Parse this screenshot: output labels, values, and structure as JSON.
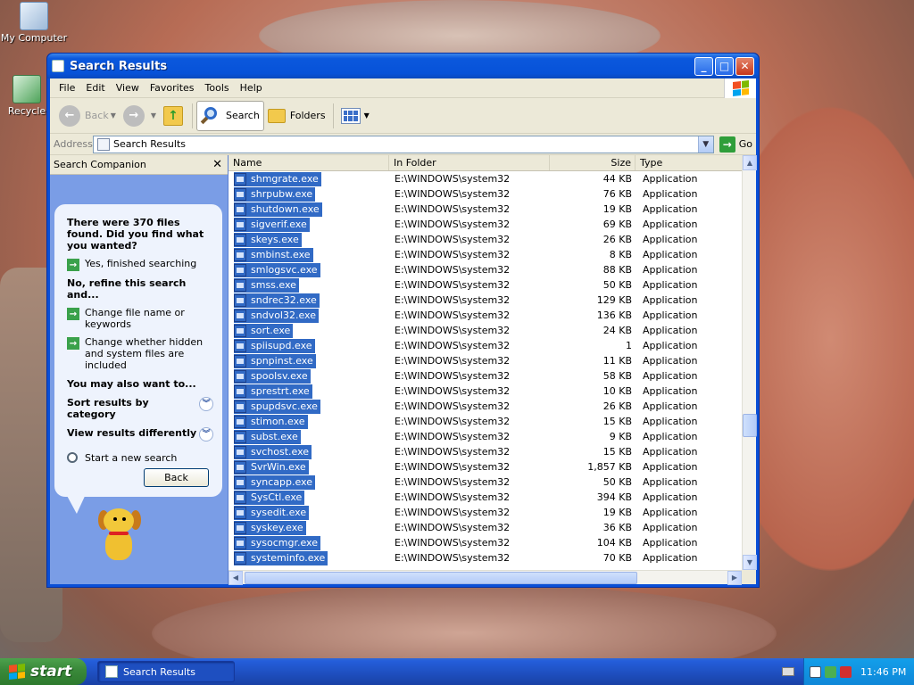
{
  "desktop": {
    "icons": [
      {
        "label": "My Computer"
      },
      {
        "label": "Recycle"
      }
    ]
  },
  "window": {
    "title": "Search Results",
    "menu": [
      "File",
      "Edit",
      "View",
      "Favorites",
      "Tools",
      "Help"
    ],
    "toolbar": {
      "back": "Back",
      "search": "Search",
      "folders": "Folders"
    },
    "address": {
      "label": "Address",
      "value": "Search Results",
      "go": "Go"
    }
  },
  "companion": {
    "header": "Search Companion",
    "found": "There were 370 files found. Did you find what you wanted?",
    "yes_finished": "Yes, finished searching",
    "refine_heading": "No, refine this search and...",
    "change_name": "Change file name or keywords",
    "change_hidden": "Change whether hidden and system files are included",
    "also_heading": "You may also want to...",
    "sort_results": "Sort results by category",
    "view_results": "View results differently",
    "new_search": "Start a new search",
    "back_button": "Back"
  },
  "results": {
    "columns": [
      "Name",
      "In Folder",
      "Size",
      "Type"
    ],
    "rows": [
      {
        "name": "shmgrate.exe",
        "folder": "E:\\WINDOWS\\system32",
        "size": "44 KB",
        "type": "Application"
      },
      {
        "name": "shrpubw.exe",
        "folder": "E:\\WINDOWS\\system32",
        "size": "76 KB",
        "type": "Application"
      },
      {
        "name": "shutdown.exe",
        "folder": "E:\\WINDOWS\\system32",
        "size": "19 KB",
        "type": "Application"
      },
      {
        "name": "sigverif.exe",
        "folder": "E:\\WINDOWS\\system32",
        "size": "69 KB",
        "type": "Application"
      },
      {
        "name": "skeys.exe",
        "folder": "E:\\WINDOWS\\system32",
        "size": "26 KB",
        "type": "Application"
      },
      {
        "name": "smbinst.exe",
        "folder": "E:\\WINDOWS\\system32",
        "size": "8 KB",
        "type": "Application"
      },
      {
        "name": "smlogsvc.exe",
        "folder": "E:\\WINDOWS\\system32",
        "size": "88 KB",
        "type": "Application"
      },
      {
        "name": "smss.exe",
        "folder": "E:\\WINDOWS\\system32",
        "size": "50 KB",
        "type": "Application"
      },
      {
        "name": "sndrec32.exe",
        "folder": "E:\\WINDOWS\\system32",
        "size": "129 KB",
        "type": "Application"
      },
      {
        "name": "sndvol32.exe",
        "folder": "E:\\WINDOWS\\system32",
        "size": "136 KB",
        "type": "Application"
      },
      {
        "name": "sort.exe",
        "folder": "E:\\WINDOWS\\system32",
        "size": "24 KB",
        "type": "Application"
      },
      {
        "name": "spiisupd.exe",
        "folder": "E:\\WINDOWS\\system32",
        "size": "1",
        "type": "Application"
      },
      {
        "name": "spnpinst.exe",
        "folder": "E:\\WINDOWS\\system32",
        "size": "11 KB",
        "type": "Application"
      },
      {
        "name": "spoolsv.exe",
        "folder": "E:\\WINDOWS\\system32",
        "size": "58 KB",
        "type": "Application"
      },
      {
        "name": "sprestrt.exe",
        "folder": "E:\\WINDOWS\\system32",
        "size": "10 KB",
        "type": "Application"
      },
      {
        "name": "spupdsvc.exe",
        "folder": "E:\\WINDOWS\\system32",
        "size": "26 KB",
        "type": "Application"
      },
      {
        "name": "stimon.exe",
        "folder": "E:\\WINDOWS\\system32",
        "size": "15 KB",
        "type": "Application"
      },
      {
        "name": "subst.exe",
        "folder": "E:\\WINDOWS\\system32",
        "size": "9 KB",
        "type": "Application"
      },
      {
        "name": "svchost.exe",
        "folder": "E:\\WINDOWS\\system32",
        "size": "15 KB",
        "type": "Application"
      },
      {
        "name": "SvrWin.exe",
        "folder": "E:\\WINDOWS\\system32",
        "size": "1,857 KB",
        "type": "Application"
      },
      {
        "name": "syncapp.exe",
        "folder": "E:\\WINDOWS\\system32",
        "size": "50 KB",
        "type": "Application"
      },
      {
        "name": "SysCtl.exe",
        "folder": "E:\\WINDOWS\\system32",
        "size": "394 KB",
        "type": "Application"
      },
      {
        "name": "sysedit.exe",
        "folder": "E:\\WINDOWS\\system32",
        "size": "19 KB",
        "type": "Application"
      },
      {
        "name": "syskey.exe",
        "folder": "E:\\WINDOWS\\system32",
        "size": "36 KB",
        "type": "Application"
      },
      {
        "name": "sysocmgr.exe",
        "folder": "E:\\WINDOWS\\system32",
        "size": "104 KB",
        "type": "Application"
      },
      {
        "name": "systeminfo.exe",
        "folder": "E:\\WINDOWS\\system32",
        "size": "70 KB",
        "type": "Application"
      }
    ]
  },
  "taskbar": {
    "start": "start",
    "task": "Search Results",
    "clock": "11:46 PM"
  },
  "colors": {
    "selection": "#316ac5",
    "window_blue": "#0a4fd6",
    "taskbar_blue": "#245edb",
    "start_green": "#3b8a3b"
  }
}
